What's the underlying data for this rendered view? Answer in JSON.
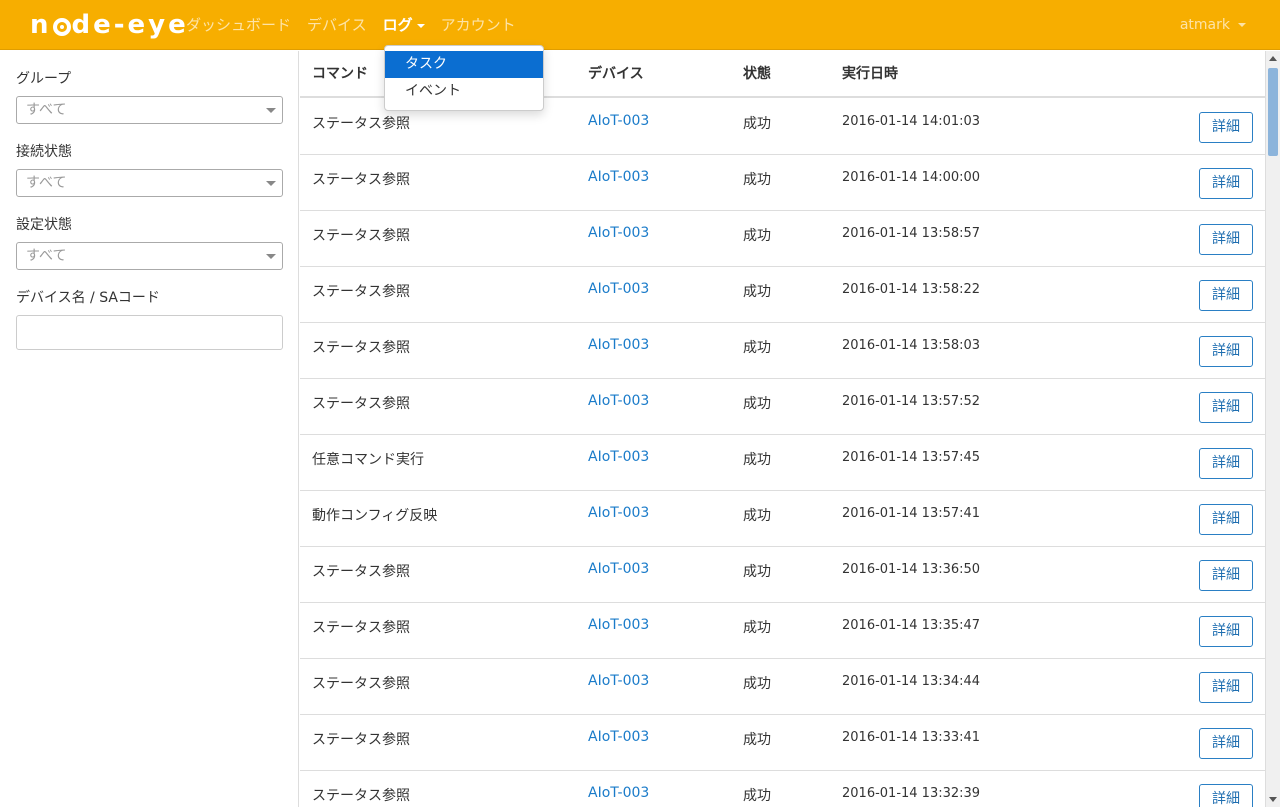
{
  "navbar": {
    "brand_left": "n",
    "brand_right": "de-eye",
    "items": [
      {
        "label": "ダッシュボード"
      },
      {
        "label": "デバイス"
      },
      {
        "label": "ログ"
      },
      {
        "label": "アカウント"
      }
    ],
    "user": "atmark",
    "color": "#f7ae00"
  },
  "dropdown": {
    "items": [
      {
        "label": "タスク",
        "selected": true
      },
      {
        "label": "イベント",
        "selected": false
      }
    ]
  },
  "filters": {
    "group_label": "グループ",
    "group_value": "すべて",
    "connection_label": "接続状態",
    "connection_value": "すべて",
    "config_label": "設定状態",
    "config_value": "すべて",
    "name_label": "デバイス名 / SAコード",
    "name_value": ""
  },
  "table": {
    "headers": {
      "command": "コマンド",
      "device": "デバイス",
      "status": "状態",
      "datetime": "実行日時"
    },
    "detail_label": "詳細",
    "rows": [
      {
        "command": "ステータス参照",
        "device": "AIoT-003",
        "status": "成功",
        "datetime": "2016-01-14 14:01:03"
      },
      {
        "command": "ステータス参照",
        "device": "AIoT-003",
        "status": "成功",
        "datetime": "2016-01-14 14:00:00"
      },
      {
        "command": "ステータス参照",
        "device": "AIoT-003",
        "status": "成功",
        "datetime": "2016-01-14 13:58:57"
      },
      {
        "command": "ステータス参照",
        "device": "AIoT-003",
        "status": "成功",
        "datetime": "2016-01-14 13:58:22"
      },
      {
        "command": "ステータス参照",
        "device": "AIoT-003",
        "status": "成功",
        "datetime": "2016-01-14 13:58:03"
      },
      {
        "command": "ステータス参照",
        "device": "AIoT-003",
        "status": "成功",
        "datetime": "2016-01-14 13:57:52"
      },
      {
        "command": "任意コマンド実行",
        "device": "AIoT-003",
        "status": "成功",
        "datetime": "2016-01-14 13:57:45"
      },
      {
        "command": "動作コンフィグ反映",
        "device": "AIoT-003",
        "status": "成功",
        "datetime": "2016-01-14 13:57:41"
      },
      {
        "command": "ステータス参照",
        "device": "AIoT-003",
        "status": "成功",
        "datetime": "2016-01-14 13:36:50"
      },
      {
        "command": "ステータス参照",
        "device": "AIoT-003",
        "status": "成功",
        "datetime": "2016-01-14 13:35:47"
      },
      {
        "command": "ステータス参照",
        "device": "AIoT-003",
        "status": "成功",
        "datetime": "2016-01-14 13:34:44"
      },
      {
        "command": "ステータス参照",
        "device": "AIoT-003",
        "status": "成功",
        "datetime": "2016-01-14 13:33:41"
      },
      {
        "command": "ステータス参照",
        "device": "AIoT-003",
        "status": "成功",
        "datetime": "2016-01-14 13:32:39"
      }
    ]
  }
}
